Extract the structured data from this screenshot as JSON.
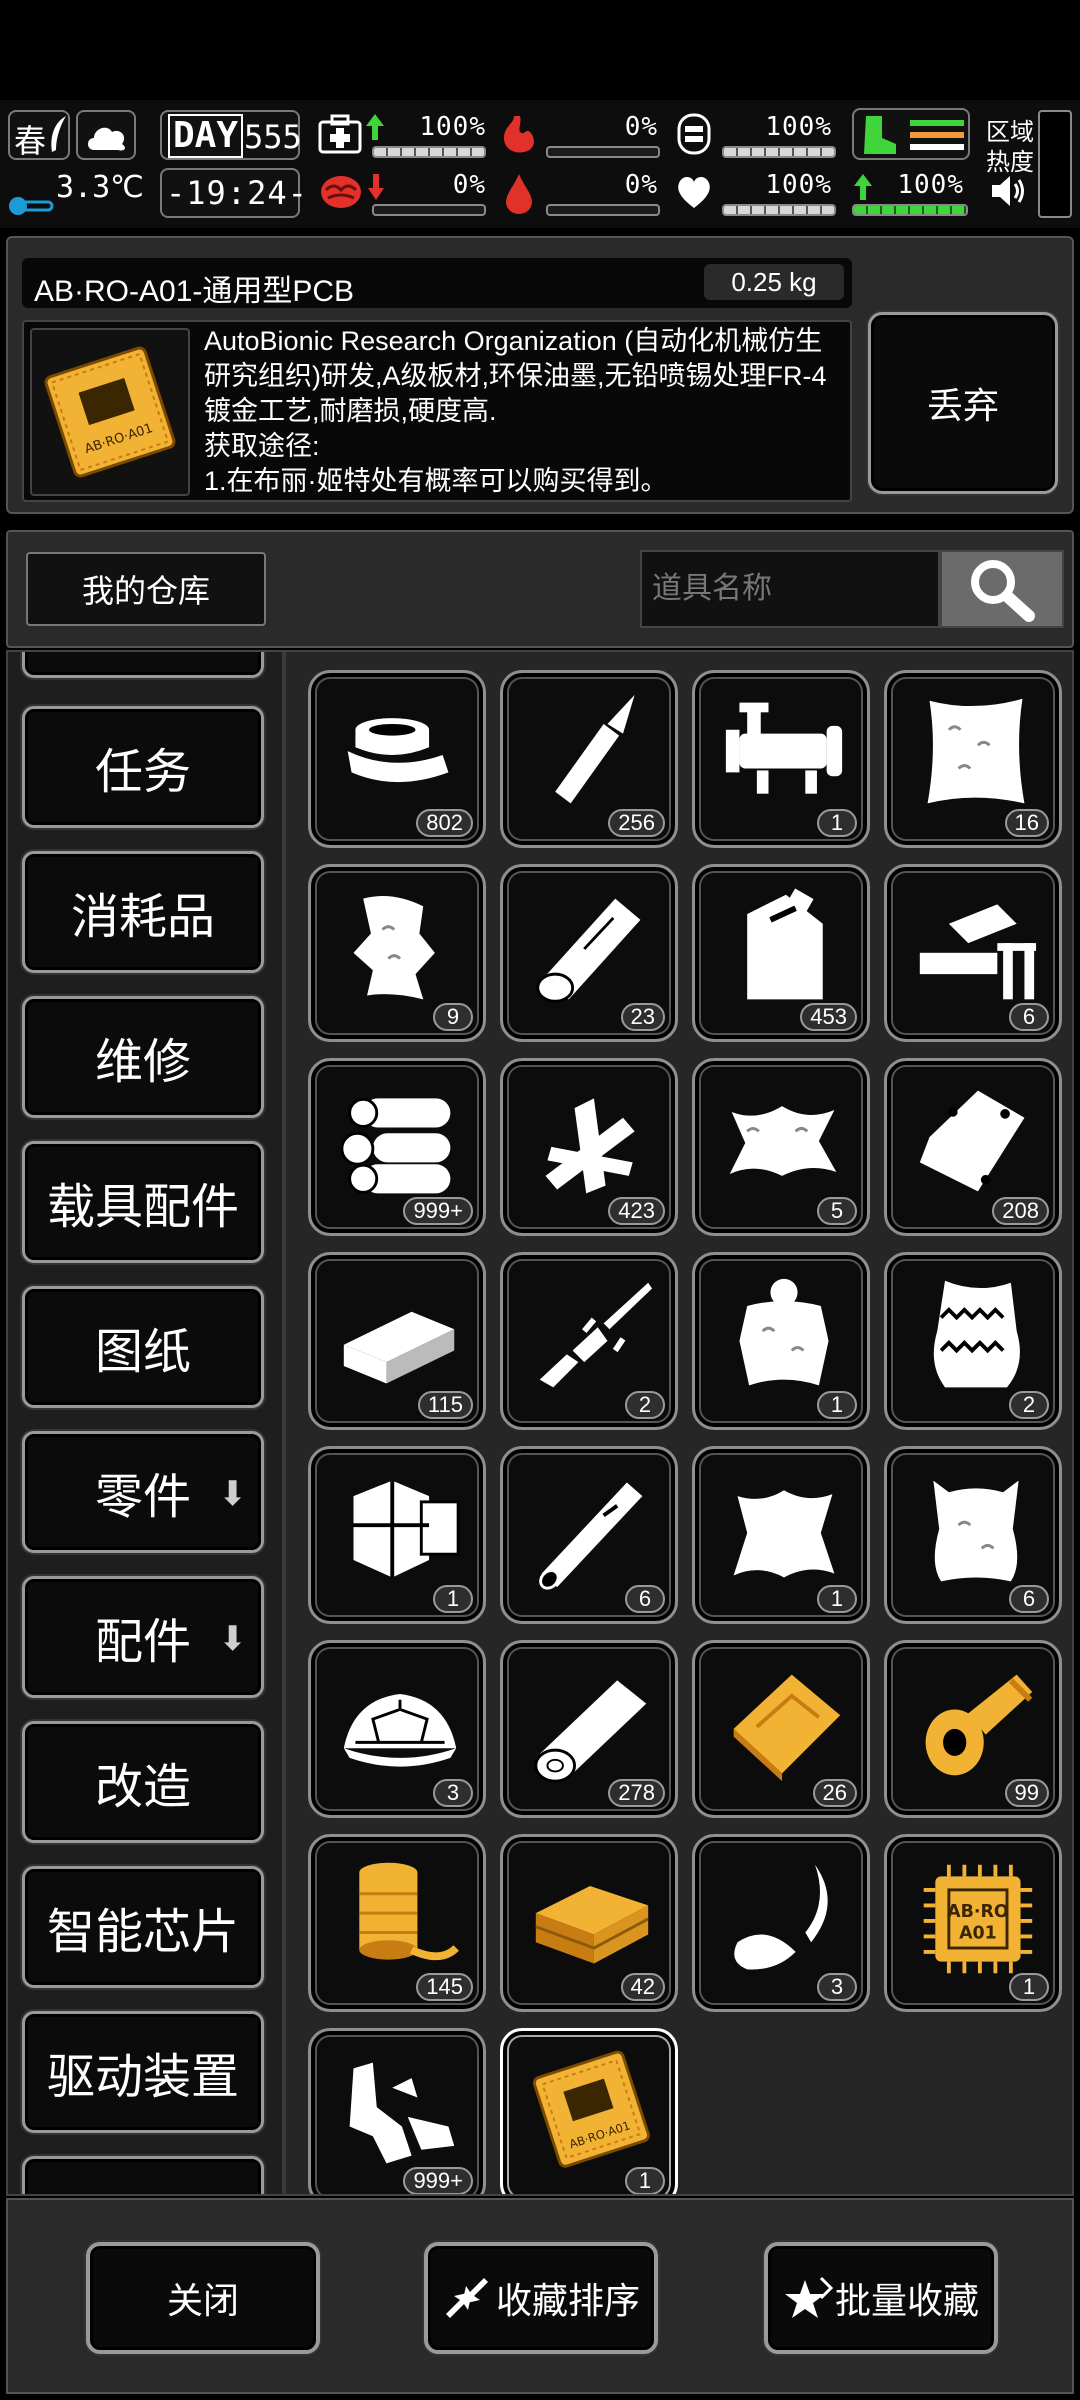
{
  "status": {
    "season": "春",
    "temperature": "3.3℃",
    "day_label": "DAY",
    "day": "555",
    "time": "-19:24-",
    "health_pct": "100%",
    "hunger_pct": "0%",
    "stamina_pct": "100%",
    "infection_pct": "0%",
    "bleeding_pct": "0%",
    "mood_pct": "100%",
    "leg_pct": "100%",
    "region_heat": "区域\n热度"
  },
  "item": {
    "title": "AB·RO-A01-通用型PCB",
    "weight": "0.25 kg",
    "description": "AutoBionic Research Organization (自动化机械仿生研究组织)研发,A级板材,环保油墨,无铅喷锡处理FR-4镀金工艺,耐磨损,硬度高.\n获取途径:\n1.在布丽·姬特处有概率可以购买得到。",
    "thumb_label": "AB·RO·A01",
    "discard_label": "丢弃"
  },
  "warehouse_tab": "我的仓库",
  "search": {
    "placeholder": "道具名称"
  },
  "sidebar": {
    "items": [
      {
        "label": "任务"
      },
      {
        "label": "消耗品"
      },
      {
        "label": "维修"
      },
      {
        "label": "载具配件"
      },
      {
        "label": "图纸"
      },
      {
        "label": "零件"
      },
      {
        "label": "配件"
      },
      {
        "label": "改造"
      },
      {
        "label": "智能芯片"
      },
      {
        "label": "驱动装置"
      }
    ]
  },
  "grid": {
    "items": [
      {
        "icon": "bandage-roll-icon",
        "count": "802"
      },
      {
        "icon": "glue-tube-icon",
        "count": "256"
      },
      {
        "icon": "pipe-valve-icon",
        "count": "1"
      },
      {
        "icon": "cloth-sack-icon",
        "count": "16"
      },
      {
        "icon": "fur-scrap-icon",
        "count": "9"
      },
      {
        "icon": "wood-log-icon",
        "count": "23"
      },
      {
        "icon": "jerrycan-icon",
        "count": "453"
      },
      {
        "icon": "vise-icon",
        "count": "6"
      },
      {
        "icon": "log-pile-icon",
        "count": "999+"
      },
      {
        "icon": "wood-planks-icon",
        "count": "423"
      },
      {
        "icon": "animal-pelt-icon",
        "count": "5"
      },
      {
        "icon": "plastic-bag-icon",
        "count": "208"
      },
      {
        "icon": "brick-icon",
        "count": "115"
      },
      {
        "icon": "broken-rifle-icon",
        "count": "2"
      },
      {
        "icon": "bear-pelt-icon",
        "count": "1"
      },
      {
        "icon": "wool-sack-icon",
        "count": "2"
      },
      {
        "icon": "engine-part-icon",
        "count": "1"
      },
      {
        "icon": "steel-pipe-icon",
        "count": "6"
      },
      {
        "icon": "hide-icon",
        "count": "1"
      },
      {
        "icon": "fabric-sack-icon",
        "count": "6"
      },
      {
        "icon": "turtle-shell-icon",
        "count": "3"
      },
      {
        "icon": "timber-icon",
        "count": "278"
      },
      {
        "icon": "gold-plate-icon",
        "count": "26"
      },
      {
        "icon": "gold-tape-icon",
        "count": "99"
      },
      {
        "icon": "gold-spool-icon",
        "count": "145"
      },
      {
        "icon": "gold-ingot-icon",
        "count": "42"
      },
      {
        "icon": "feather-hook-icon",
        "count": "3"
      },
      {
        "icon": "chip-icon",
        "count": "1"
      },
      {
        "icon": "metal-scrap-icon",
        "count": "999+"
      },
      {
        "icon": "pcb-board-icon",
        "count": "1"
      }
    ]
  },
  "bottom": {
    "close_label": "关闭",
    "sort_label": "收藏排序",
    "batch_label": "批量收藏"
  },
  "colors": {
    "gold": "#f2b233",
    "green": "#3fd43a",
    "red": "#e2312a"
  }
}
